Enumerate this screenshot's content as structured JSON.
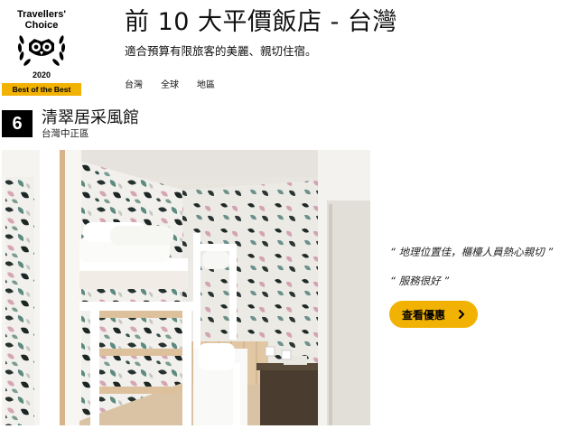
{
  "badge": {
    "line1": "Travellers'",
    "line2": "Choice",
    "year": "2020",
    "strip": "Best of the Best",
    "brand_color": "#f2b203"
  },
  "header": {
    "title": "前 10 大平價飯店 - 台灣",
    "subtitle": "適合預算有限旅客的美麗、親切住宿。",
    "tabs": [
      {
        "label": "台灣"
      },
      {
        "label": "全球"
      },
      {
        "label": "地區"
      }
    ]
  },
  "hotel": {
    "rank": "6",
    "name": "清翠居采風館",
    "location": "台灣中正區",
    "photo_icon": "hotel-room-photo"
  },
  "reviews": [
    {
      "text": "“ 地理位置佳，櫃檯人員熱心親切 ”"
    },
    {
      "text": "“ 服務很好 ”"
    }
  ],
  "cta": {
    "label": "查看優惠",
    "icon": "chevron-right-icon",
    "color": "#f2b203"
  }
}
